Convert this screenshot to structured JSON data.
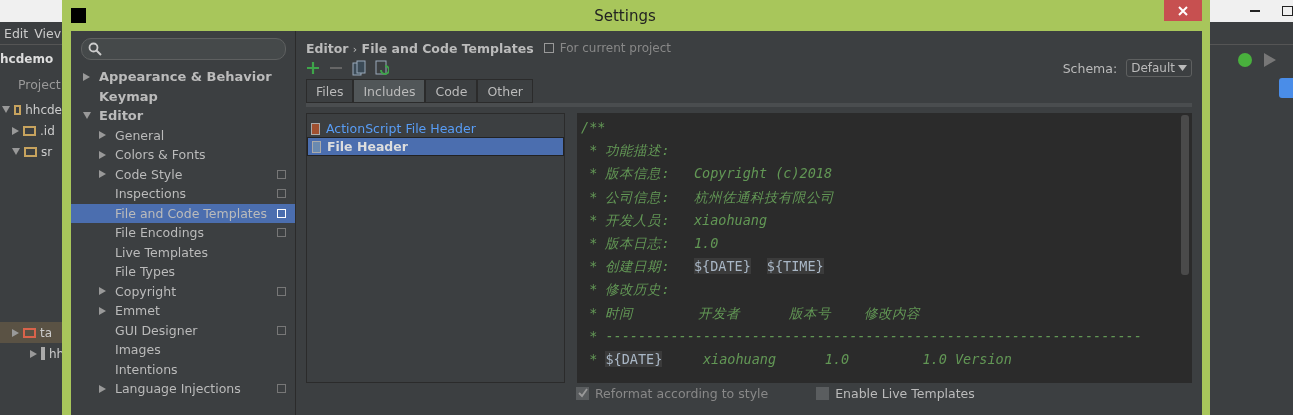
{
  "ide_background": {
    "menu": [
      "Edit",
      "Viev"
    ],
    "project_name": "hcdemo",
    "tool_window": "Project",
    "tree": [
      {
        "label": "hhcde",
        "kind": "module",
        "expanded": true,
        "selected": false
      },
      {
        "label": ".id",
        "kind": "folder",
        "expanded": false,
        "selected": false
      },
      {
        "label": "sr",
        "kind": "folder",
        "expanded": true,
        "selected": false
      },
      {
        "label": "ta",
        "kind": "excluded",
        "expanded": false,
        "selected": true
      },
      {
        "label": "hh",
        "kind": "file",
        "expanded": false,
        "selected": false
      }
    ]
  },
  "window": {
    "title": "Settings"
  },
  "sidebar": {
    "items": [
      {
        "label": "Appearance & Behavior",
        "expandable": true,
        "expanded": false,
        "selected": false
      },
      {
        "label": "Keymap",
        "expandable": false,
        "selected": false
      },
      {
        "label": "Editor",
        "expandable": true,
        "expanded": true,
        "selected": false,
        "children": [
          {
            "label": "General",
            "expandable": true,
            "selected": false,
            "project_level": false
          },
          {
            "label": "Colors & Fonts",
            "expandable": true,
            "selected": false,
            "project_level": false
          },
          {
            "label": "Code Style",
            "expandable": true,
            "selected": false,
            "project_level": true
          },
          {
            "label": "Inspections",
            "expandable": false,
            "selected": false,
            "project_level": true
          },
          {
            "label": "File and Code Templates",
            "expandable": false,
            "selected": true,
            "project_level": true
          },
          {
            "label": "File Encodings",
            "expandable": false,
            "selected": false,
            "project_level": true
          },
          {
            "label": "Live Templates",
            "expandable": false,
            "selected": false,
            "project_level": false
          },
          {
            "label": "File Types",
            "expandable": false,
            "selected": false,
            "project_level": false
          },
          {
            "label": "Copyright",
            "expandable": true,
            "selected": false,
            "project_level": true
          },
          {
            "label": "Emmet",
            "expandable": true,
            "selected": false,
            "project_level": false
          },
          {
            "label": "GUI Designer",
            "expandable": false,
            "selected": false,
            "project_level": true
          },
          {
            "label": "Images",
            "expandable": false,
            "selected": false,
            "project_level": false
          },
          {
            "label": "Intentions",
            "expandable": false,
            "selected": false,
            "project_level": false
          },
          {
            "label": "Language Injections",
            "expandable": true,
            "selected": false,
            "project_level": true
          }
        ]
      }
    ]
  },
  "breadcrumb": {
    "parent": "Editor",
    "separator": "›",
    "current": "File and Code Templates",
    "scope": "For current project"
  },
  "schema": {
    "label": "Schema:",
    "value": "Default"
  },
  "tabs": [
    {
      "label": "Files",
      "selected": false
    },
    {
      "label": "Includes",
      "selected": true
    },
    {
      "label": "Code",
      "selected": false
    },
    {
      "label": "Other",
      "selected": false
    }
  ],
  "templates": [
    {
      "label": "ActionScript File Header",
      "kind": "actionscript",
      "selected": false
    },
    {
      "label": "File Header",
      "kind": "java",
      "selected": true
    }
  ],
  "editor": {
    "lines": [
      [
        {
          "kind": "comment",
          "text": "/**"
        }
      ],
      [
        {
          "kind": "comment",
          "text": " * 功能描述:"
        }
      ],
      [
        {
          "kind": "comment",
          "text": " * 版本信息:   Copyright (c)2018"
        }
      ],
      [
        {
          "kind": "comment",
          "text": " * 公司信息:   杭州佐通科技有限公司"
        }
      ],
      [
        {
          "kind": "comment",
          "text": " * 开发人员:   xiaohuang"
        }
      ],
      [
        {
          "kind": "comment",
          "text": " * 版本日志:   1.0"
        }
      ],
      [
        {
          "kind": "comment",
          "text": " * 创建日期:   "
        },
        {
          "kind": "variable",
          "text": "${DATE}"
        },
        {
          "kind": "variable",
          "text": "${TIME}"
        }
      ],
      [
        {
          "kind": "comment",
          "text": " * 修改历史:"
        }
      ],
      [
        {
          "kind": "comment",
          "text": " * 时间        开发者      版本号    修改内容"
        }
      ],
      [
        {
          "kind": "comment",
          "text": " * ------------------------------------------------------------------"
        }
      ],
      [
        {
          "kind": "comment",
          "text": " * "
        },
        {
          "kind": "variable",
          "text": "${DATE}"
        },
        {
          "kind": "comment",
          "text": "     xiaohuang      1.0         1.0 Version"
        }
      ]
    ]
  },
  "options": [
    {
      "label": "Reformat according to style",
      "checked": true,
      "disabled": true
    },
    {
      "label": "Enable Live Templates",
      "checked": false,
      "disabled": false
    }
  ]
}
